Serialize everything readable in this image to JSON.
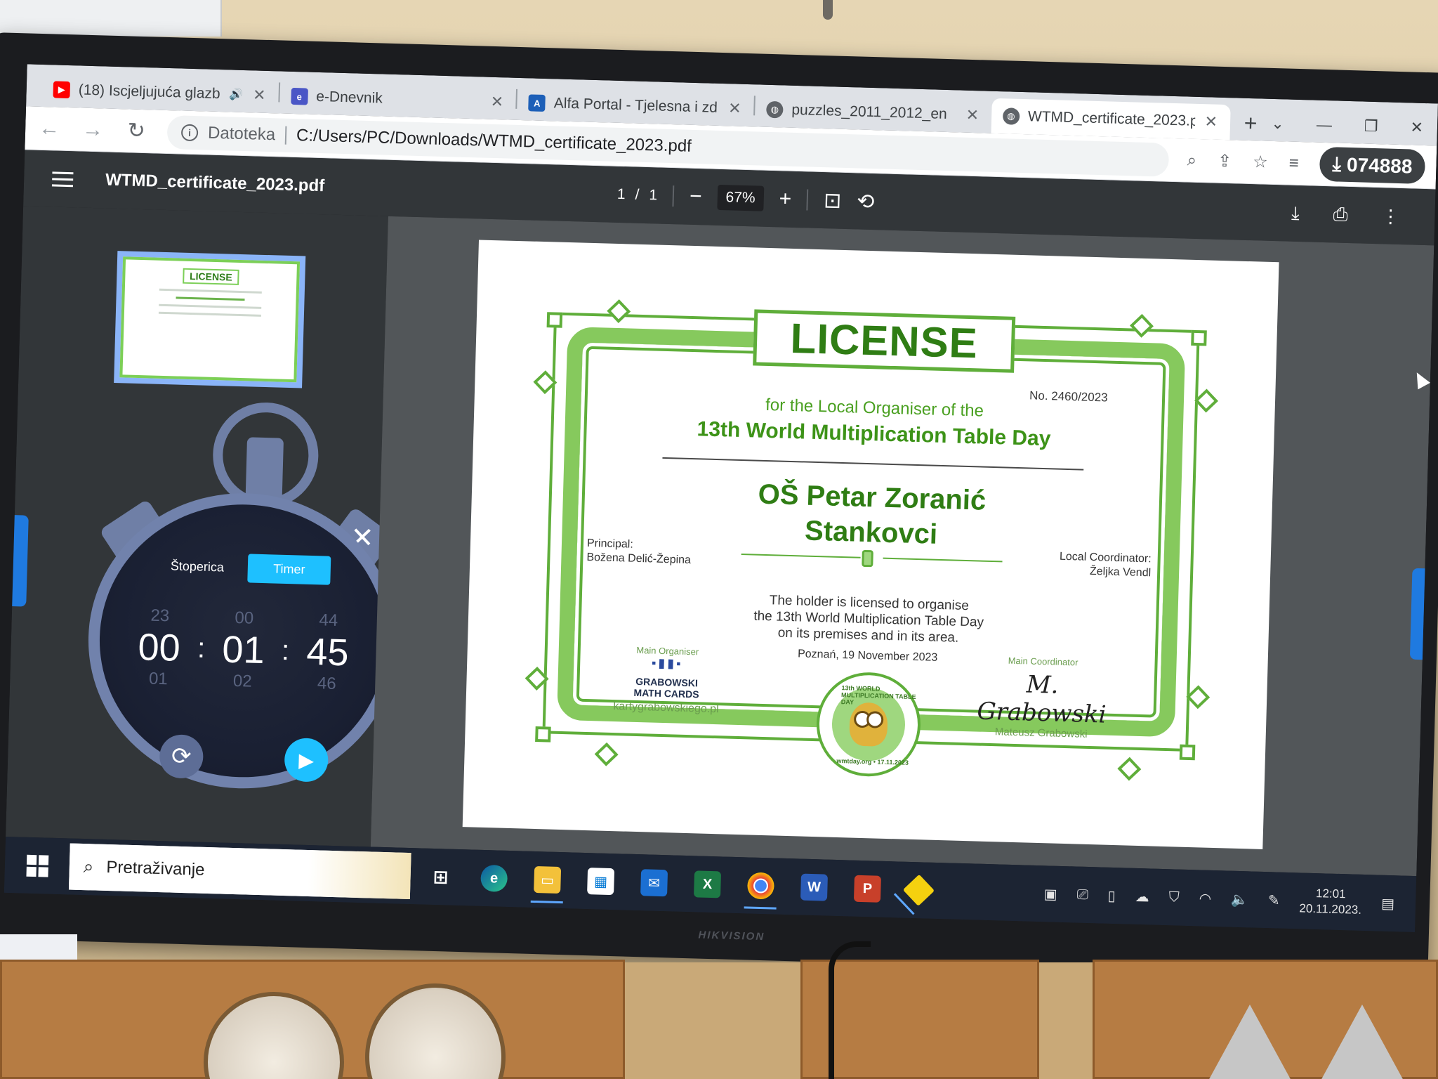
{
  "browser": {
    "tabs": [
      {
        "title": "(18) Iscjeljujuća glazb",
        "favicon": "youtube-icon",
        "audio": true,
        "active": false
      },
      {
        "title": "e-Dnevnik",
        "favicon": "ednevnik-icon",
        "audio": false,
        "active": false
      },
      {
        "title": "Alfa Portal - Tjelesna i zd",
        "favicon": "alfa-icon",
        "audio": false,
        "active": false
      },
      {
        "title": "puzzles_2011_2012_en",
        "favicon": "globe-icon",
        "audio": false,
        "active": false
      },
      {
        "title": "WTMD_certificate_2023.p",
        "favicon": "globe-icon",
        "audio": false,
        "active": true
      }
    ],
    "address": {
      "scheme_label": "Datoteka",
      "url": "C:/Users/PC/Downloads/WTMD_certificate_2023.pdf"
    },
    "profile_badge": "074888"
  },
  "pdf": {
    "filename": "WTMD_certificate_2023.pdf",
    "page_current": "1",
    "page_sep": "/",
    "page_total": "1",
    "zoom": "67%"
  },
  "timer": {
    "mode_stopwatch": "Štoperica",
    "mode_timer": "Timer",
    "active_mode": "Timer",
    "above": [
      "23",
      "00",
      "44"
    ],
    "current": [
      "00",
      "01",
      "45"
    ],
    "below": [
      "01",
      "02",
      "46"
    ],
    "separator": ":"
  },
  "certificate": {
    "title": "LICENSE",
    "number": "No. 2460/2023",
    "for_line": "for the Local Organiser of the",
    "event": "13th World Multiplication Table Day",
    "school_line1": "OŠ Petar Zoranić",
    "school_line2": "Stankovci",
    "principal_label": "Principal:",
    "principal_name": "Božena Delić-Žepina",
    "coordinator_label": "Local Coordinator:",
    "coordinator_name": "Željka Vendl",
    "body_lines": [
      "The holder is licensed to organise",
      "the 13th World Multiplication Table Day",
      "on its premises and in its area."
    ],
    "date": "Poznań, 19 November 2023",
    "organiser_label": "Main Organiser",
    "organiser_logo_line1": "GRABOWSKI",
    "organiser_logo_line2": "MATH CARDS",
    "organiser_url": "kartygrabowskiego.pl",
    "main_coordinator_label": "Main Coordinator",
    "main_coordinator_name": "Mateusz Grabowski",
    "seal_top": "13th WORLD MULTIPLICATION TABLE DAY",
    "seal_bottom": "wmtday.org • 17.11.2023",
    "accent_color": "#5fae3a",
    "title_color": "#2f7d14"
  },
  "taskbar": {
    "search_placeholder": "Pretraživanje",
    "apps": [
      {
        "name": "task-view-icon",
        "active": false
      },
      {
        "name": "edge-icon",
        "active": false
      },
      {
        "name": "file-explorer-icon",
        "active": true
      },
      {
        "name": "store-icon",
        "active": false
      },
      {
        "name": "mail-icon",
        "active": false
      },
      {
        "name": "excel-icon",
        "active": false
      },
      {
        "name": "chrome-icon",
        "active": true
      },
      {
        "name": "word-icon",
        "active": false
      },
      {
        "name": "powerpoint-icon",
        "active": false
      },
      {
        "name": "app-diamond-icon",
        "active": true
      }
    ],
    "time": "12:01",
    "date": "20.11.2023."
  },
  "hardware": {
    "monitor_brand": "HIKVISION"
  }
}
